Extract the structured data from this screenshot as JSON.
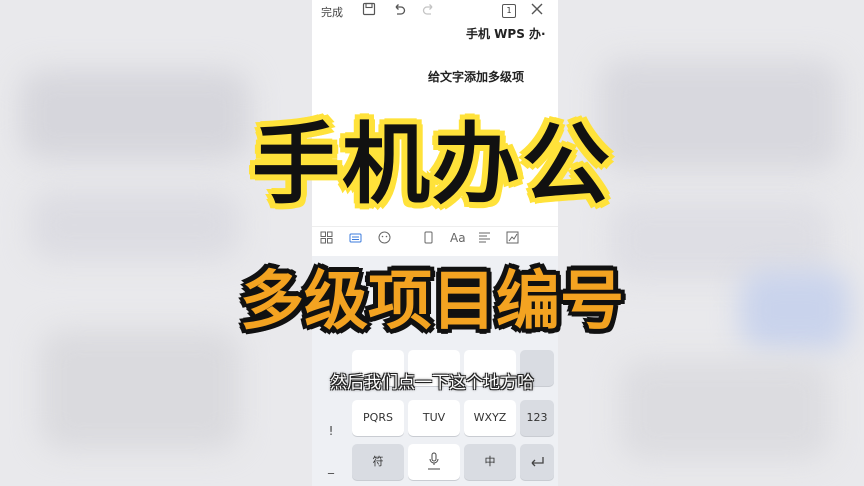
{
  "toolbar": {
    "done_label": "完成",
    "save_icon": "save-icon",
    "undo_icon": "undo-icon",
    "redo_icon": "redo-icon",
    "page_count": "1",
    "close_icon": "close-icon"
  },
  "document": {
    "title": "手机 WPS 办·",
    "subtitle": "给文字添加多级项"
  },
  "format_bar": {
    "icons": [
      "grid-icon",
      "keyboard-icon",
      "emoji-icon",
      "copy-icon",
      "font-icon",
      "align-icon",
      "chart-icon"
    ]
  },
  "keyboard": {
    "left_keys": [
      "!",
      "_"
    ],
    "row3": [
      "PQRS",
      "TUV",
      "WXYZ",
      "123"
    ],
    "row4": {
      "symbol": "符",
      "mic_icon": "mic-icon",
      "lang": "中",
      "enter_icon": "enter-icon"
    }
  },
  "overlay": {
    "headline": "手机办公",
    "sub_headline": "多级项目编号",
    "caption": "然后我们点一下这个地方哈"
  },
  "colors": {
    "headline_outline": "#ffe23a",
    "sub_headline_fill": "#f3a321"
  }
}
